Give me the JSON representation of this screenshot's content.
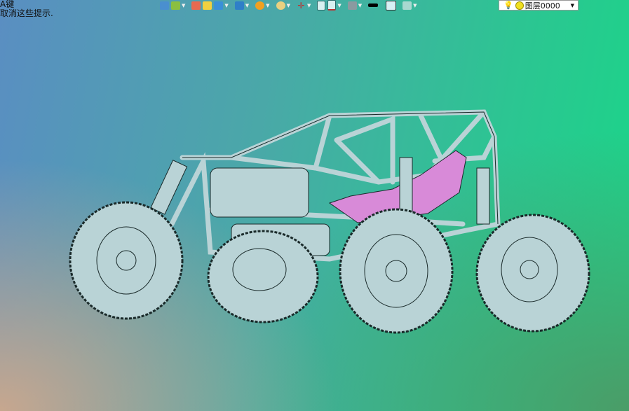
{
  "hints": {
    "line1": "A键",
    "line2": "取消这些提示."
  },
  "toolbar": {
    "icons": [
      "back-arrow-icon",
      "snap-icon",
      "pen-icon",
      "box-face-icon",
      "cube-icon",
      "view-cube-icon",
      "render-wheel-icon",
      "light-bulb-icon",
      "axis-cross-icon",
      "page-icon",
      "page-red-icon",
      "monitor-icon",
      "line-color-icon",
      "fill-color-icon",
      "layer-stack-icon"
    ],
    "layer_select": {
      "value": "图层0000"
    }
  },
  "colors": {
    "frame": "#b9d3d6",
    "seat": "#d88ad8",
    "outline": "#1a2a2a"
  }
}
